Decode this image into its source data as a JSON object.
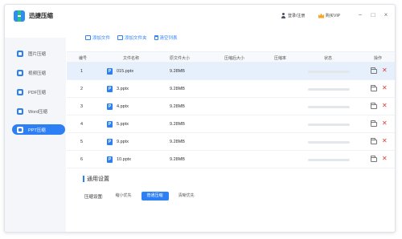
{
  "app": {
    "title": "迅捷压缩"
  },
  "topbar": {
    "login_label": "登录/注册",
    "vip_label": "购买VIP",
    "controls": [
      "−",
      "□",
      "×"
    ]
  },
  "sidebar": {
    "items": [
      {
        "label": "图片压缩",
        "icon": "image-icon",
        "active": false
      },
      {
        "label": "视频压缩",
        "icon": "video-icon",
        "active": false
      },
      {
        "label": "PDF压缩",
        "icon": "pdf-icon",
        "active": false
      },
      {
        "label": "Word压缩",
        "icon": "word-icon",
        "active": false
      },
      {
        "label": "PPT压缩",
        "icon": "ppt-icon",
        "active": true
      }
    ]
  },
  "toolbar": {
    "add_file": "添加文件",
    "add_folder": "添加文件夹",
    "clear_list": "清空列表"
  },
  "table": {
    "headers": [
      "编号",
      "文件名称",
      "原文件大小",
      "压缩后大小",
      "压缩率",
      "状态",
      "操作"
    ],
    "rows": [
      {
        "index": "1",
        "name": "015.pptx",
        "size": "9.28MB",
        "progress": 0,
        "selected": true
      },
      {
        "index": "2",
        "name": "3.pptx",
        "size": "9.28MB",
        "progress": 0,
        "selected": false
      },
      {
        "index": "3",
        "name": "4.pptx",
        "size": "9.28MB",
        "progress": 0,
        "selected": false
      },
      {
        "index": "4",
        "name": "5.pptx",
        "size": "9.28MB",
        "progress": 0,
        "selected": false
      },
      {
        "index": "5",
        "name": "9.pptx",
        "size": "9.28MB",
        "progress": 0,
        "selected": false
      },
      {
        "index": "6",
        "name": "10.pptx",
        "size": "9.28MB",
        "progress": 0,
        "selected": false
      }
    ]
  },
  "settings": {
    "title": "通用设置",
    "label": "压缩设置:",
    "options": [
      {
        "label": "缩小优先",
        "active": false
      },
      {
        "label": "普通压缩",
        "active": true
      },
      {
        "label": "清晰优先",
        "active": false
      }
    ]
  },
  "colors": {
    "accent": "#2d7ff5",
    "selected_row": "#e6f0fd",
    "delete": "#e53935",
    "sidebar_bg": "#f4f6fa"
  }
}
